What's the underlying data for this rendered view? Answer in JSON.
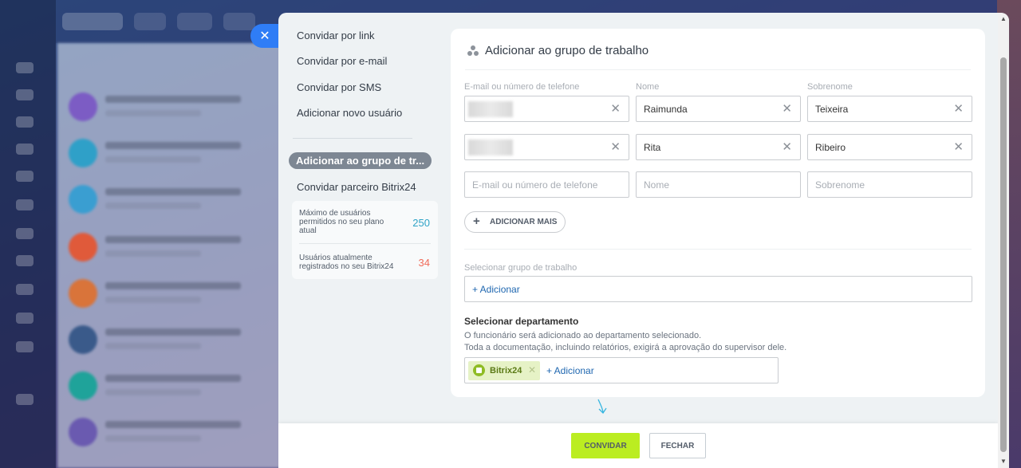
{
  "menu": {
    "items": [
      {
        "label": "Convidar por link"
      },
      {
        "label": "Convidar por e-mail"
      },
      {
        "label": "Convidar por SMS"
      },
      {
        "label": "Adicionar novo usuário"
      }
    ],
    "active_label": "Adicionar ao grupo de tr...",
    "partner_label": "Convidar parceiro Bitrix24"
  },
  "stats": {
    "max_label": "Máximo de usuários permitidos no seu plano atual",
    "max_value": "250",
    "max_color": "#2fa3c7",
    "registered_label": "Usuários atualmente registrados no seu Bitrix24",
    "registered_value": "34",
    "registered_color": "#f06b5a"
  },
  "card": {
    "title": "Adicionar ao grupo de trabalho",
    "columns": {
      "email": "E-mail ou número de telefone",
      "name": "Nome",
      "surname": "Sobrenome"
    },
    "rows": [
      {
        "email": "",
        "name": "Raimunda",
        "surname": "Teixeira"
      },
      {
        "email": "",
        "name": "Rita",
        "surname": "Ribeiro"
      }
    ],
    "placeholders": {
      "email": "E-mail ou número de telefone",
      "name": "Nome",
      "surname": "Sobrenome"
    },
    "add_more_label": "ADICIONAR MAIS",
    "workgroup_label": "Selecionar grupo de trabalho",
    "workgroup_add": "+ Adicionar",
    "department_title": "Selecionar departamento",
    "department_desc_1": "O funcionário será adicionado ao departamento selecionado.",
    "department_desc_2": "Toda a documentação, incluindo relatórios, exigirá a aprovação do supervisor dele.",
    "department_chip": "Bitrix24",
    "department_add": "+ Adicionar"
  },
  "footer": {
    "invite_label": "CONVIDAR",
    "close_label": "FECHAR"
  },
  "icons": {
    "close": "close-icon",
    "group": "group-icon",
    "clear": "clear-icon",
    "plus": "plus-icon",
    "department": "department-icon",
    "arrow": "arrow-down-icon"
  },
  "colors": {
    "accent_blue": "#2f7df6",
    "invite_green": "#bbed21",
    "link_blue": "#1f67b0"
  }
}
